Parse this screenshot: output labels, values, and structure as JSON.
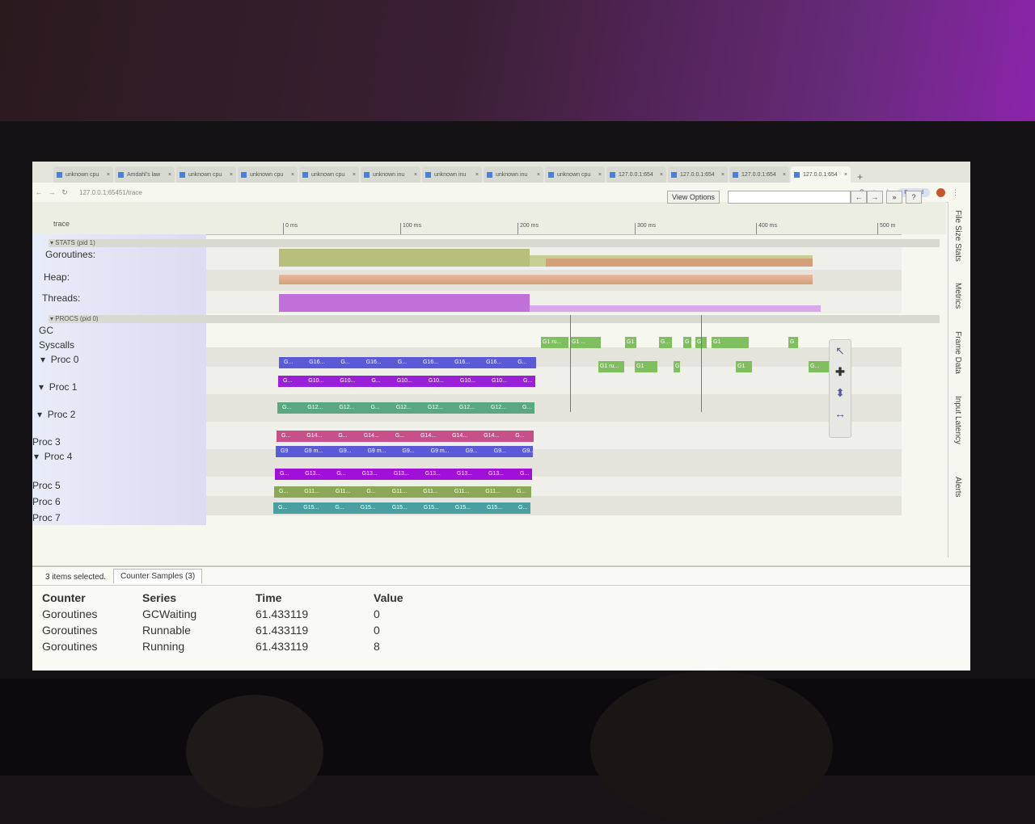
{
  "tabs": [
    {
      "label": "unknown cpu",
      "active": false
    },
    {
      "label": "Amdahl's law",
      "active": false
    },
    {
      "label": "unknown cpu",
      "active": false
    },
    {
      "label": "unknown cpu",
      "active": false
    },
    {
      "label": "unknown cpu",
      "active": false
    },
    {
      "label": "unknown inu",
      "active": false
    },
    {
      "label": "unknown inu",
      "active": false
    },
    {
      "label": "unknown inu",
      "active": false
    },
    {
      "label": "unknown cpu",
      "active": false
    },
    {
      "label": "127.0.0.1:654",
      "active": false
    },
    {
      "label": "127.0.0.1:654",
      "active": false
    },
    {
      "label": "127.0.0.1:654",
      "active": false
    },
    {
      "label": "127.0.0.1:654",
      "active": true
    }
  ],
  "new_tab_label": "+",
  "address": {
    "url": "127.0.0.1:65451/trace",
    "paused_label": "Paused"
  },
  "toolbar": {
    "trace_label": "trace",
    "view_options_label": "View Options",
    "prev_label": "←",
    "next_label": "→",
    "expand_label": "»",
    "help_label": "?"
  },
  "ruler_ticks": [
    "0 ms",
    "100 ms",
    "200 ms",
    "300 ms",
    "400 ms",
    "500 m"
  ],
  "stats_section": {
    "header": "STATS (pid 1)",
    "rows": [
      "Goroutines:",
      "Heap:",
      "Threads:"
    ]
  },
  "procs_section": {
    "header": "PROCS (pid 0)",
    "rows": [
      "GC",
      "Syscalls",
      "Proc 0",
      "Proc 1",
      "Proc 2",
      "Proc 3",
      "Proc 4",
      "Proc 5",
      "Proc 6",
      "Proc 7"
    ]
  },
  "slice_rows": [
    {
      "color": "#5a5ad6",
      "labels": [
        "G...",
        "G16...",
        "G...",
        "G16...",
        "G...",
        "G16...",
        "G16...",
        "G16...",
        "G...",
        "G..."
      ]
    },
    {
      "color": "#9a20d8",
      "labels": [
        "G...",
        "G10...",
        "G10...",
        "G...",
        "G10...",
        "G10...",
        "G10...",
        "G10...",
        "G...",
        "G10..."
      ]
    },
    {
      "color": "#5aa882",
      "labels": [
        "G...",
        "G12...",
        "G12...",
        "G...",
        "G12...",
        "G12...",
        "G12...",
        "G12...",
        "G...",
        "G..."
      ]
    },
    {
      "color": "#c8508a",
      "labels": [
        "G...",
        "G14...",
        "G...",
        "G14...",
        "G...",
        "G14...",
        "G14...",
        "G14...",
        "G...",
        "G..."
      ]
    },
    {
      "color": "#5a5ad6",
      "labels": [
        "G9",
        "G9 m...",
        "G9...",
        "G9 m...",
        "G9...",
        "G9 m...",
        "G9...",
        "G9...",
        "G9...",
        "G9..."
      ]
    },
    {
      "color": "#a010d8",
      "labels": [
        "G...",
        "G13...",
        "G...",
        "G13...",
        "G13...",
        "G13...",
        "G13...",
        "G13...",
        "G...",
        "G13..."
      ]
    },
    {
      "color": "#8aa858",
      "labels": [
        "G...",
        "G11...",
        "G11...",
        "G...",
        "G11...",
        "G11...",
        "G11...",
        "G11...",
        "G...",
        "G11..."
      ]
    },
    {
      "color": "#4aa0a0",
      "labels": [
        "G...",
        "G15...",
        "G...",
        "G15...",
        "G15...",
        "G15...",
        "G15...",
        "G15...",
        "G...",
        "G15..."
      ]
    }
  ],
  "sparse_slices_row1": [
    "G1 ru...",
    "G1 ...",
    "G1",
    "G...",
    "G",
    "G",
    "G1",
    "G"
  ],
  "sparse_slices_row2": [
    "G1 ru...",
    "G1",
    "G",
    "G1",
    "G..."
  ],
  "side_tabs": [
    "File Size Stats",
    "Metrics",
    "Frame Data",
    "Input Latency",
    "Alerts"
  ],
  "tools": [
    {
      "name": "select-tool",
      "icon": "arrow-pointer"
    },
    {
      "name": "pan-tool",
      "icon": "plus-move"
    },
    {
      "name": "zoom-tool",
      "icon": "zoom-arrows"
    },
    {
      "name": "timing-tool",
      "icon": "horizontal-range"
    }
  ],
  "bottom_panel": {
    "selection_count": "3 items selected.",
    "tab_label": "Counter Samples (3)",
    "columns": [
      "Counter",
      "Series",
      "Time",
      "Value"
    ],
    "rows": [
      [
        "Goroutines",
        "GCWaiting",
        "61.433119",
        "0"
      ],
      [
        "Goroutines",
        "Runnable",
        "61.433119",
        "0"
      ],
      [
        "Goroutines",
        "Running",
        "61.433119",
        "8"
      ]
    ]
  },
  "colors": {
    "goroutines_counter": "#b8bf7c",
    "heap_counter": "#d4a07a",
    "threads_counter": "#c070d8",
    "proc_label_bg": "#dcdcf2"
  }
}
